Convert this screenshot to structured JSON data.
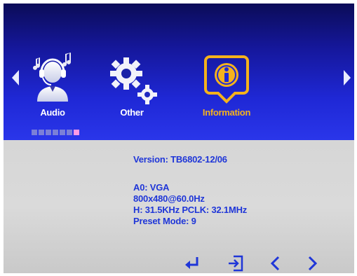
{
  "menu": {
    "items": [
      {
        "label": "Audio",
        "icon": "headset-person-icon",
        "selected": false
      },
      {
        "label": "Other",
        "icon": "gears-icon",
        "selected": false
      },
      {
        "label": "Information",
        "icon": "info-icon",
        "selected": true
      }
    ],
    "page_indicator": {
      "total": 7,
      "active": 7
    },
    "colors": {
      "selected": "#f5b21c",
      "text": "#ffffff",
      "info_text": "#1f36d8"
    }
  },
  "info": {
    "version": "Version: TB6802-12/06",
    "input": "A0: VGA",
    "resolution": "800x480@60.0Hz",
    "timing": "H: 31.5KHz  PCLK: 32.1MHz",
    "preset": "Preset Mode:   9"
  },
  "nav_buttons": [
    "enter-icon",
    "exit-icon",
    "chevron-left-icon",
    "chevron-right-icon"
  ]
}
